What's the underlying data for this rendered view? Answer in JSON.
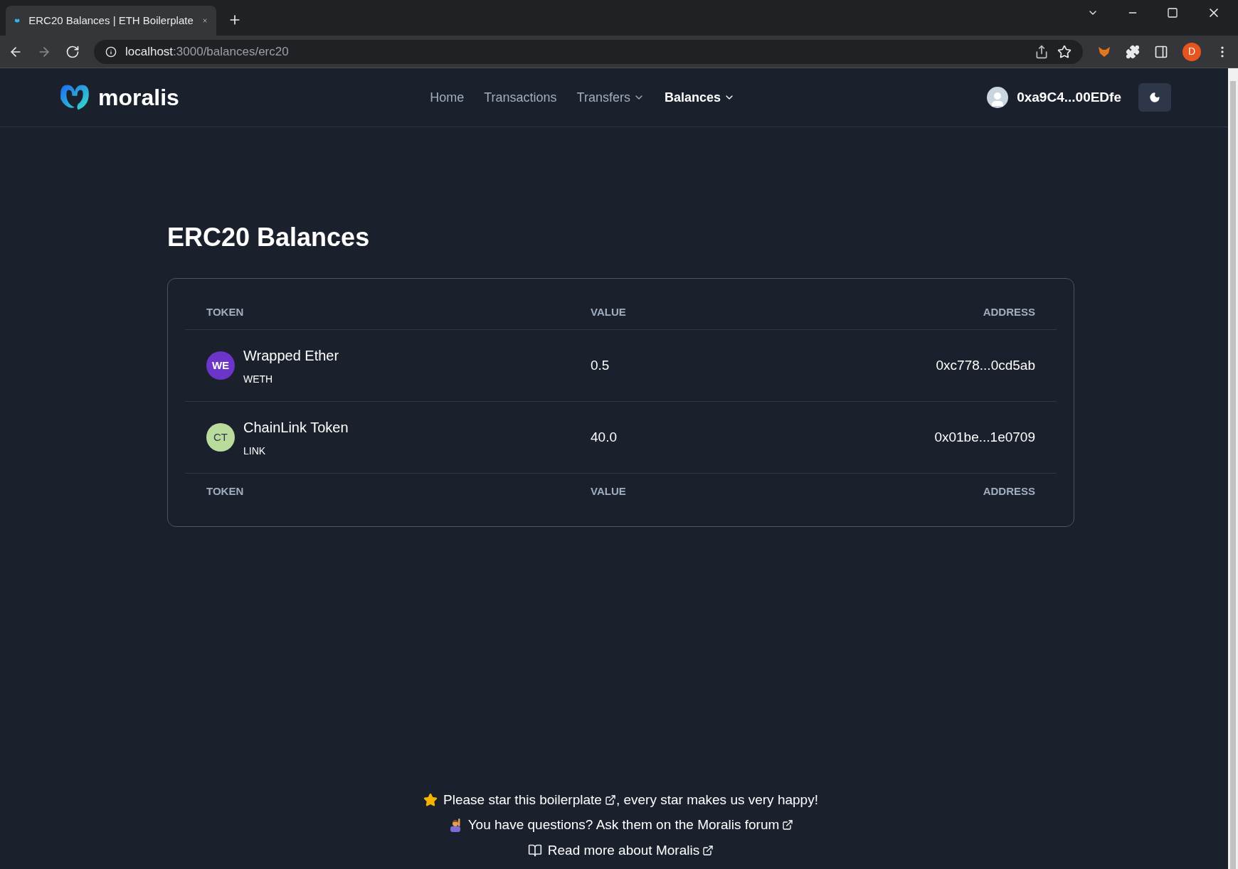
{
  "browser": {
    "tab_title": "ERC20 Balances | ETH Boilerplate",
    "url_host": "localhost",
    "url_path": ":3000/balances/erc20",
    "profile_initial": "D"
  },
  "header": {
    "logo_text": "moralis",
    "nav": [
      {
        "label": "Home",
        "selected": false,
        "dropdown": false
      },
      {
        "label": "Transactions",
        "selected": false,
        "dropdown": false
      },
      {
        "label": "Transfers",
        "selected": false,
        "dropdown": true
      },
      {
        "label": "Balances",
        "selected": true,
        "dropdown": true
      }
    ],
    "account": "0xa9C4...00EDfe"
  },
  "page_title": "ERC20 Balances",
  "table": {
    "columns": [
      "TOKEN",
      "VALUE",
      "ADDRESS"
    ],
    "rows": [
      {
        "initials": "WE",
        "color": "#6b35c9",
        "name": "Wrapped Ether",
        "symbol": "WETH",
        "value": "0.5",
        "address": "0xc778...0cd5ab"
      },
      {
        "initials": "CT",
        "color": "#b9dc9d",
        "name": "ChainLink Token",
        "symbol": "LINK",
        "value": "40.0",
        "address": "0x01be...1e0709"
      }
    ],
    "footer_columns": [
      "TOKEN",
      "VALUE",
      "ADDRESS"
    ]
  },
  "footer": [
    {
      "kind": "star",
      "before": "Please star this ",
      "link": "boilerplate",
      "after": ", every star makes us very happy!"
    },
    {
      "kind": "person",
      "before": "You have questions? Ask them on the ",
      "link": "Moralis forum"
    },
    {
      "kind": "book",
      "before": "Read more about ",
      "link": "Moralis"
    }
  ]
}
